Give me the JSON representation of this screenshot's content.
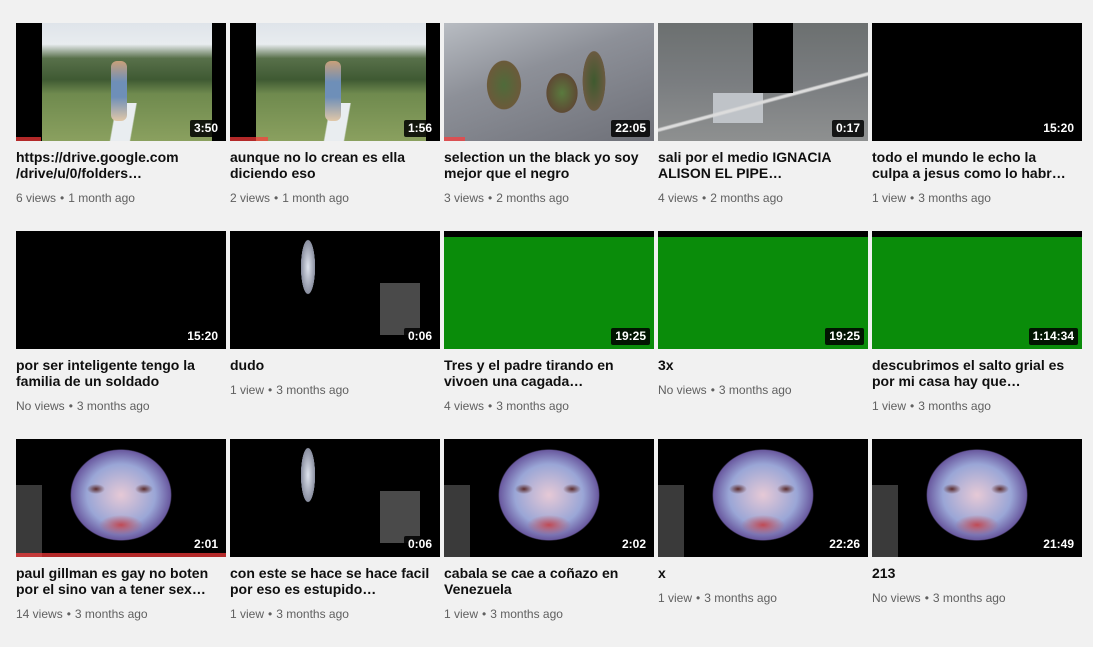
{
  "videos": [
    {
      "title": "https://drive.google.com /drive/u/0/folders…",
      "duration": "3:50",
      "views": "6 views",
      "age": "1 month ago",
      "art": "field",
      "progress": 0.12
    },
    {
      "title": "aunque no lo crean es ella diciendo eso",
      "duration": "1:56",
      "views": "2 views",
      "age": "1 month ago",
      "art": "field",
      "progress": 0.18
    },
    {
      "title": "selection un the black yo soy mejor que el negro",
      "duration": "22:05",
      "views": "3 views",
      "age": "2 months ago",
      "art": "garden",
      "progress": 0.1
    },
    {
      "title": "sali por el medio IGNACIA ALISON EL PIPE…",
      "duration": "0:17",
      "views": "4 views",
      "age": "2 months ago",
      "art": "room",
      "progress": 0
    },
    {
      "title": "todo el mundo le echo la culpa a jesus como lo habr…",
      "duration": "15:20",
      "views": "1 view",
      "age": "3 months ago",
      "art": "black",
      "progress": 0
    },
    {
      "title": "por ser inteligente tengo la familia de un soldado",
      "duration": "15:20",
      "views": "No views",
      "age": "3 months ago",
      "art": "black",
      "progress": 0
    },
    {
      "title": "dudo",
      "duration": "0:06",
      "views": "1 view",
      "age": "3 months ago",
      "art": "shard",
      "progress": 0
    },
    {
      "title": "Tres y el padre tirando en vivoen una cagada…",
      "duration": "19:25",
      "views": "4 views",
      "age": "3 months ago",
      "art": "green",
      "progress": 0
    },
    {
      "title": "3x",
      "duration": "19:25",
      "views": "No views",
      "age": "3 months ago",
      "art": "green",
      "progress": 0
    },
    {
      "title": "descubrimos el salto grial es por mi casa hay que…",
      "duration": "1:14:34",
      "views": "1 view",
      "age": "3 months ago",
      "art": "green",
      "progress": 0
    },
    {
      "title": "paul gillman es gay no boten por el sino van a tener sex…",
      "duration": "2:01",
      "views": "14 views",
      "age": "3 months ago",
      "art": "face",
      "progress": 1
    },
    {
      "title": "con este se hace se hace facil por eso es estupido…",
      "duration": "0:06",
      "views": "1 view",
      "age": "3 months ago",
      "art": "shard",
      "progress": 0
    },
    {
      "title": "cabala se cae a coñazo en Venezuela",
      "duration": "2:02",
      "views": "1 view",
      "age": "3 months ago",
      "art": "face",
      "progress": 0
    },
    {
      "title": "x",
      "duration": "22:26",
      "views": "1 view",
      "age": "3 months ago",
      "art": "face",
      "progress": 0
    },
    {
      "title": "213",
      "duration": "21:49",
      "views": "No views",
      "age": "3 months ago",
      "art": "face",
      "progress": 0
    }
  ],
  "separator": "•",
  "colors": {
    "background": "#f1f1f1",
    "progress": "#ff3b3b",
    "duration_bg": "#000000"
  }
}
